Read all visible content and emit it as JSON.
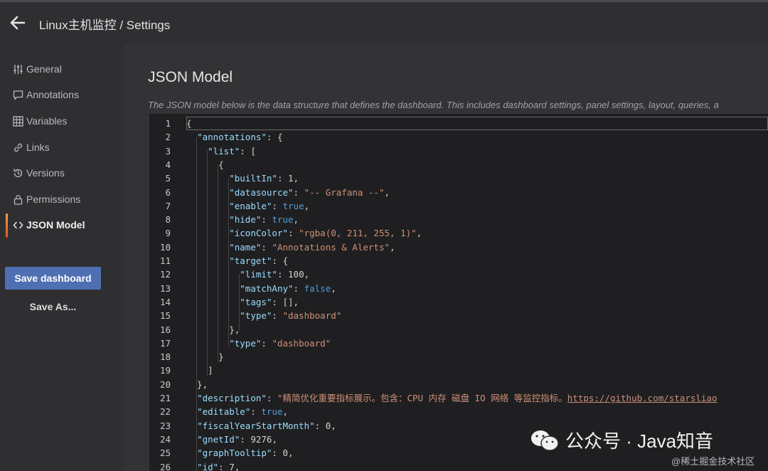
{
  "header": {
    "title": "Linux主机监控 / Settings"
  },
  "sidebar": {
    "items": [
      {
        "label": "General",
        "icon": "sliders-icon"
      },
      {
        "label": "Annotations",
        "icon": "comment-icon"
      },
      {
        "label": "Variables",
        "icon": "table-icon"
      },
      {
        "label": "Links",
        "icon": "link-icon"
      },
      {
        "label": "Versions",
        "icon": "history-icon"
      },
      {
        "label": "Permissions",
        "icon": "lock-icon"
      },
      {
        "label": "JSON Model",
        "icon": "code-brackets-icon",
        "active": true
      }
    ],
    "save_label": "Save dashboard",
    "save_as_label": "Save As..."
  },
  "main": {
    "heading": "JSON Model",
    "description": "The JSON model below is the data structure that defines the dashboard. This includes dashboard settings, panel settings, layout, queries, a"
  },
  "editor": {
    "line_numbers": [
      "1",
      "2",
      "3",
      "4",
      "5",
      "6",
      "7",
      "8",
      "9",
      "10",
      "11",
      "12",
      "13",
      "14",
      "15",
      "16",
      "17",
      "18",
      "19",
      "20",
      "21",
      "22",
      "23",
      "24",
      "25",
      "26"
    ],
    "lines": [
      [
        [
          "p",
          "{"
        ]
      ],
      [
        [
          "p",
          "  "
        ],
        [
          "k",
          "\"annotations\""
        ],
        [
          "p",
          ": {"
        ]
      ],
      [
        [
          "p",
          "    "
        ],
        [
          "k",
          "\"list\""
        ],
        [
          "p",
          ": ["
        ]
      ],
      [
        [
          "p",
          "      {"
        ]
      ],
      [
        [
          "p",
          "        "
        ],
        [
          "k",
          "\"builtIn\""
        ],
        [
          "p",
          ": "
        ],
        [
          "n",
          "1"
        ],
        [
          "p",
          ","
        ]
      ],
      [
        [
          "p",
          "        "
        ],
        [
          "k",
          "\"datasource\""
        ],
        [
          "p",
          ": "
        ],
        [
          "s",
          "\"-- Grafana --\""
        ],
        [
          "p",
          ","
        ]
      ],
      [
        [
          "p",
          "        "
        ],
        [
          "k",
          "\"enable\""
        ],
        [
          "p",
          ": "
        ],
        [
          "b",
          "true"
        ],
        [
          "p",
          ","
        ]
      ],
      [
        [
          "p",
          "        "
        ],
        [
          "k",
          "\"hide\""
        ],
        [
          "p",
          ": "
        ],
        [
          "b",
          "true"
        ],
        [
          "p",
          ","
        ]
      ],
      [
        [
          "p",
          "        "
        ],
        [
          "k",
          "\"iconColor\""
        ],
        [
          "p",
          ": "
        ],
        [
          "s",
          "\"rgba(0, 211, 255, 1)\""
        ],
        [
          "p",
          ","
        ]
      ],
      [
        [
          "p",
          "        "
        ],
        [
          "k",
          "\"name\""
        ],
        [
          "p",
          ": "
        ],
        [
          "s",
          "\"Annotations & Alerts\""
        ],
        [
          "p",
          ","
        ]
      ],
      [
        [
          "p",
          "        "
        ],
        [
          "k",
          "\"target\""
        ],
        [
          "p",
          ": {"
        ]
      ],
      [
        [
          "p",
          "          "
        ],
        [
          "k",
          "\"limit\""
        ],
        [
          "p",
          ": "
        ],
        [
          "n",
          "100"
        ],
        [
          "p",
          ","
        ]
      ],
      [
        [
          "p",
          "          "
        ],
        [
          "k",
          "\"matchAny\""
        ],
        [
          "p",
          ": "
        ],
        [
          "b",
          "false"
        ],
        [
          "p",
          ","
        ]
      ],
      [
        [
          "p",
          "          "
        ],
        [
          "k",
          "\"tags\""
        ],
        [
          "p",
          ": [],"
        ]
      ],
      [
        [
          "p",
          "          "
        ],
        [
          "k",
          "\"type\""
        ],
        [
          "p",
          ": "
        ],
        [
          "s",
          "\"dashboard\""
        ]
      ],
      [
        [
          "p",
          "        },"
        ]
      ],
      [
        [
          "p",
          "        "
        ],
        [
          "k",
          "\"type\""
        ],
        [
          "p",
          ": "
        ],
        [
          "s",
          "\"dashboard\""
        ]
      ],
      [
        [
          "p",
          "      }"
        ]
      ],
      [
        [
          "p",
          "    ]"
        ]
      ],
      [
        [
          "p",
          "  },"
        ]
      ],
      [
        [
          "p",
          "  "
        ],
        [
          "k",
          "\"description\""
        ],
        [
          "p",
          ": "
        ],
        [
          "s",
          "\"精简优化重要指标展示。包含：CPU 内存 磁盘 IO 网络 等监控指标。"
        ],
        [
          "u",
          "https://github.com/starsliao"
        ]
      ],
      [
        [
          "p",
          "  "
        ],
        [
          "k",
          "\"editable\""
        ],
        [
          "p",
          ": "
        ],
        [
          "b",
          "true"
        ],
        [
          "p",
          ","
        ]
      ],
      [
        [
          "p",
          "  "
        ],
        [
          "k",
          "\"fiscalYearStartMonth\""
        ],
        [
          "p",
          ": "
        ],
        [
          "n",
          "0"
        ],
        [
          "p",
          ","
        ]
      ],
      [
        [
          "p",
          "  "
        ],
        [
          "k",
          "\"gnetId\""
        ],
        [
          "p",
          ": "
        ],
        [
          "n",
          "9276"
        ],
        [
          "p",
          ","
        ]
      ],
      [
        [
          "p",
          "  "
        ],
        [
          "k",
          "\"graphTooltip\""
        ],
        [
          "p",
          ": "
        ],
        [
          "n",
          "0"
        ],
        [
          "p",
          ","
        ]
      ],
      [
        [
          "p",
          "  "
        ],
        [
          "k",
          "\"id\""
        ],
        [
          "p",
          ": "
        ],
        [
          "n",
          "7"
        ],
        [
          "p",
          ","
        ]
      ]
    ]
  },
  "watermark": {
    "text": "公众号 · Java知音",
    "sub": "@稀土掘金技术社区"
  }
}
